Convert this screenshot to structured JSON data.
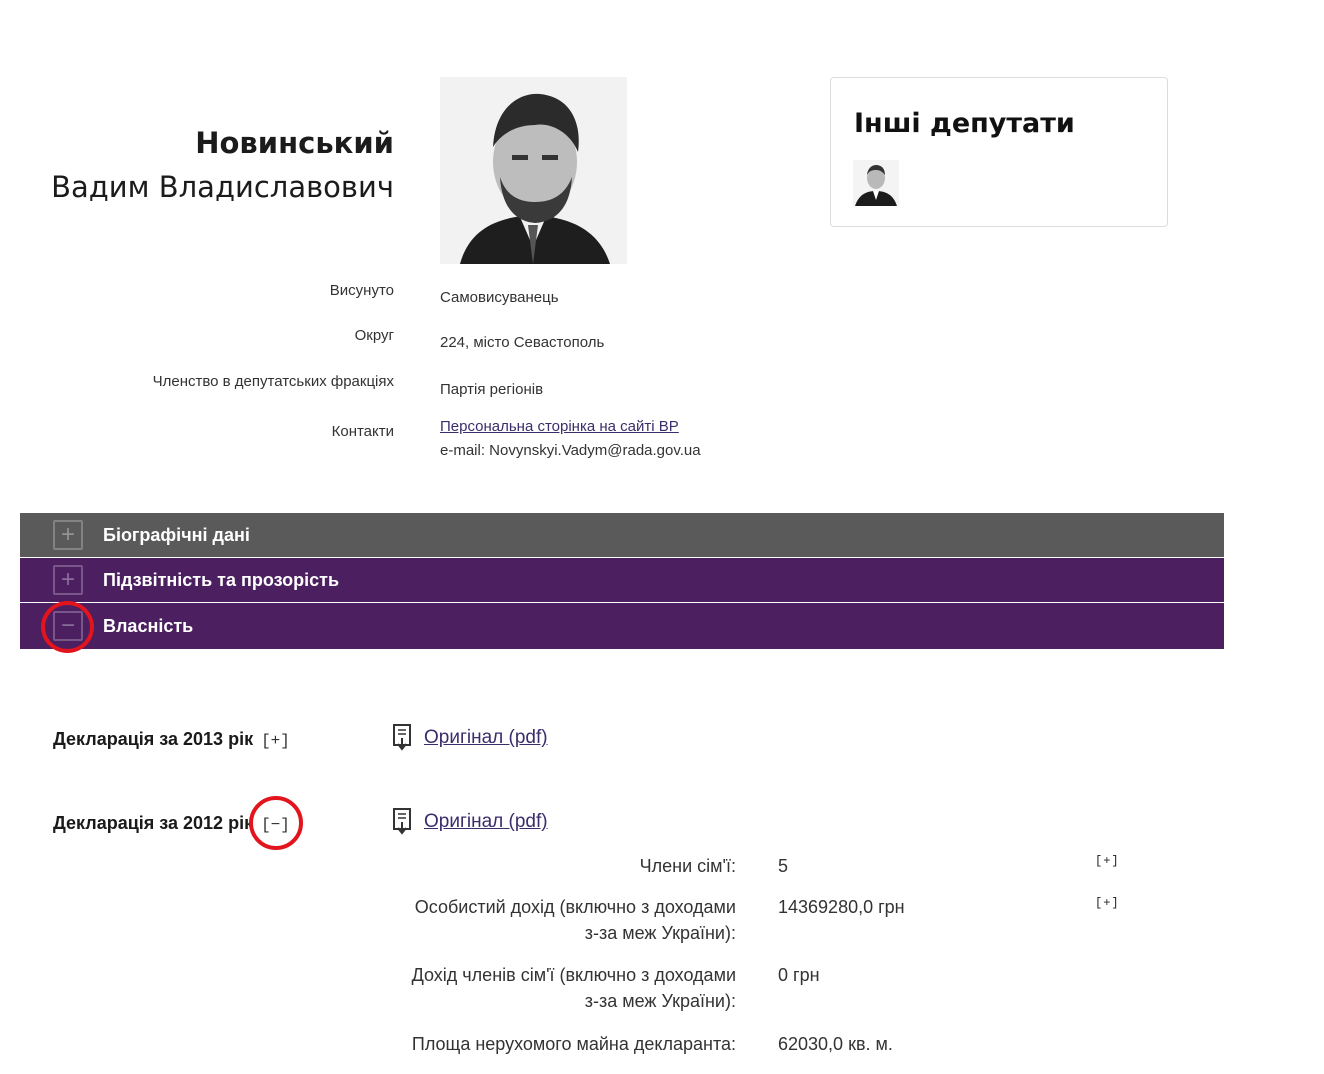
{
  "person": {
    "surname": "Новинський",
    "given_names": "Вадим Владиславович"
  },
  "info": [
    {
      "label": "Висунуто",
      "value": "Самовисуванець"
    },
    {
      "label": "Округ",
      "value": "224, місто Севастополь"
    },
    {
      "label": "Членство в депутатських фракціях",
      "value": "Партія регіонів"
    },
    {
      "label": "Контакти",
      "link": "Персональна сторінка на сайті ВР",
      "email": "e-mail: Novynskyi.Vadym@rada.gov.ua"
    }
  ],
  "others": {
    "title": "Інші депутати"
  },
  "accordion": [
    {
      "label": "Біографічні дані",
      "state": "+"
    },
    {
      "label": "Підзвітність та прозорість",
      "state": "+"
    },
    {
      "label": "Власність",
      "state": "−"
    }
  ],
  "declarations": [
    {
      "title": "Декларація за 2013 рік",
      "toggle": "[+]",
      "pdf": "Оригінал (pdf)"
    },
    {
      "title": "Декларація за 2012 рік",
      "toggle": "[−]",
      "pdf": "Оригінал (pdf)"
    }
  ],
  "details": [
    {
      "label_lines": [
        "Члени сім'ї:"
      ],
      "value": "5",
      "expand": "[+]"
    },
    {
      "label_lines": [
        "Особистий дохід (включно з доходами",
        "з-за меж України):"
      ],
      "value": "14369280,0 грн",
      "expand": "[+]"
    },
    {
      "label_lines": [
        "Дохід членів сім'ї (включно з доходами",
        "з-за меж України):"
      ],
      "value": "0 грн"
    },
    {
      "label_lines": [
        "Площа нерухомого майна декларанта:"
      ],
      "value": "62030,0 кв. м."
    }
  ],
  "colors": {
    "bar_gray": "#5a5a5a",
    "bar_purple": "#4c1f61",
    "link": "#3b2d6b",
    "highlight": "#e2141e"
  }
}
